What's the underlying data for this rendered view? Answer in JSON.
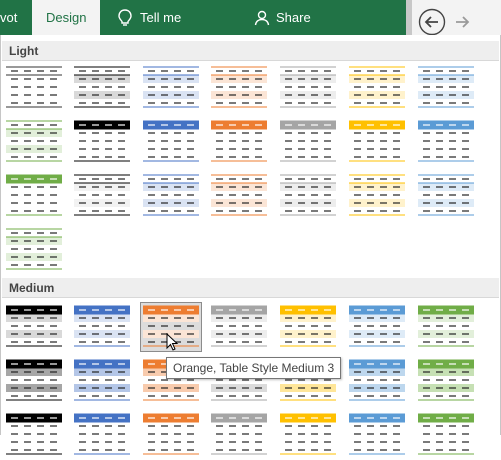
{
  "ribbon": {
    "tab_left_partial": "vot",
    "design_tab": "Design",
    "tell_me": "Tell me",
    "share": "Share",
    "back_icon": "back-arrow-icon",
    "forward_icon": "forward-arrow-icon"
  },
  "gallery": {
    "sections": [
      {
        "title": "Light"
      },
      {
        "title": "Medium"
      }
    ],
    "light": [
      {
        "accent": "#ffffff",
        "band": "#ffffff",
        "line": "#333333",
        "header_fill": false
      },
      {
        "accent": "#000000",
        "band": "#d9d9d9",
        "line": "#000000",
        "header_fill": false
      },
      {
        "accent": "#4472c4",
        "band": "#dae3f3",
        "line": "#4472c4",
        "header_fill": false
      },
      {
        "accent": "#ed7d31",
        "band": "#fbe5d6",
        "line": "#ed7d31",
        "header_fill": false
      },
      {
        "accent": "#a5a5a5",
        "band": "#ededed",
        "line": "#a5a5a5",
        "header_fill": false
      },
      {
        "accent": "#ffc000",
        "band": "#fff2cc",
        "line": "#ffc000",
        "header_fill": false
      },
      {
        "accent": "#5b9bd5",
        "band": "#deebf7",
        "line": "#5b9bd5",
        "header_fill": false
      },
      {
        "accent": "#70ad47",
        "band": "#e2efda",
        "line": "#70ad47",
        "header_fill": false
      },
      {
        "accent": "#000000",
        "band": "#ffffff",
        "line": "#000000",
        "header_fill": true
      },
      {
        "accent": "#4472c4",
        "band": "#ffffff",
        "line": "#4472c4",
        "header_fill": true
      },
      {
        "accent": "#ed7d31",
        "band": "#ffffff",
        "line": "#ed7d31",
        "header_fill": true
      },
      {
        "accent": "#a5a5a5",
        "band": "#ffffff",
        "line": "#a5a5a5",
        "header_fill": true
      },
      {
        "accent": "#ffc000",
        "band": "#ffffff",
        "line": "#ffc000",
        "header_fill": true
      },
      {
        "accent": "#5b9bd5",
        "band": "#ffffff",
        "line": "#5b9bd5",
        "header_fill": true
      },
      {
        "accent": "#70ad47",
        "band": "#ffffff",
        "line": "#70ad47",
        "header_fill": true
      },
      {
        "accent": "#000000",
        "band": "#f2f2f2",
        "line": "#000000",
        "header_fill": false
      },
      {
        "accent": "#4472c4",
        "band": "#dae3f3",
        "line": "#4472c4",
        "header_fill": false
      },
      {
        "accent": "#ed7d31",
        "band": "#fbe5d6",
        "line": "#ed7d31",
        "header_fill": false
      },
      {
        "accent": "#a5a5a5",
        "band": "#ededed",
        "line": "#a5a5a5",
        "header_fill": false
      },
      {
        "accent": "#ffc000",
        "band": "#fff2cc",
        "line": "#ffc000",
        "header_fill": false
      },
      {
        "accent": "#5b9bd5",
        "band": "#deebf7",
        "line": "#5b9bd5",
        "header_fill": false
      },
      {
        "accent": "#70ad47",
        "band": "#e2efda",
        "line": "#70ad47",
        "header_fill": false
      }
    ],
    "medium": [
      {
        "accent": "#000000",
        "band": "#d9d9d9",
        "line": "#000000",
        "header_fill": true
      },
      {
        "accent": "#4472c4",
        "band": "#dae3f3",
        "line": "#4472c4",
        "header_fill": true
      },
      {
        "accent": "#ed7d31",
        "band": "#fbe5d6",
        "line": "#ed7d31",
        "header_fill": true,
        "selected": true
      },
      {
        "accent": "#a5a5a5",
        "band": "#ededed",
        "line": "#a5a5a5",
        "header_fill": true
      },
      {
        "accent": "#ffc000",
        "band": "#fff2cc",
        "line": "#ffc000",
        "header_fill": true
      },
      {
        "accent": "#5b9bd5",
        "band": "#deebf7",
        "line": "#5b9bd5",
        "header_fill": true
      },
      {
        "accent": "#70ad47",
        "band": "#e2efda",
        "line": "#70ad47",
        "header_fill": true
      },
      {
        "accent": "#000000",
        "band": "#a6a6a6",
        "line": "#000000",
        "header_fill": true
      },
      {
        "accent": "#4472c4",
        "band": "#b4c6e7",
        "line": "#4472c4",
        "header_fill": true
      },
      {
        "accent": "#ed7d31",
        "band": "#f8cbad",
        "line": "#ed7d31",
        "header_fill": true
      },
      {
        "accent": "#a5a5a5",
        "band": "#dbdbdb",
        "line": "#a5a5a5",
        "header_fill": true
      },
      {
        "accent": "#ffc000",
        "band": "#ffe699",
        "line": "#ffc000",
        "header_fill": true
      },
      {
        "accent": "#5b9bd5",
        "band": "#bdd7ee",
        "line": "#5b9bd5",
        "header_fill": true
      },
      {
        "accent": "#70ad47",
        "band": "#c6e0b4",
        "line": "#70ad47",
        "header_fill": true
      },
      {
        "accent": "#000000",
        "band": "#ffffff",
        "line": "#000000",
        "header_fill": true
      },
      {
        "accent": "#4472c4",
        "band": "#ffffff",
        "line": "#4472c4",
        "header_fill": true
      },
      {
        "accent": "#ed7d31",
        "band": "#ffffff",
        "line": "#ed7d31",
        "header_fill": true
      },
      {
        "accent": "#a5a5a5",
        "band": "#ffffff",
        "line": "#a5a5a5",
        "header_fill": true
      },
      {
        "accent": "#ffc000",
        "band": "#ffffff",
        "line": "#ffc000",
        "header_fill": true
      },
      {
        "accent": "#5b9bd5",
        "band": "#ffffff",
        "line": "#5b9bd5",
        "header_fill": true
      },
      {
        "accent": "#70ad47",
        "band": "#ffffff",
        "line": "#70ad47",
        "header_fill": true
      }
    ]
  },
  "tooltip": {
    "text": "Orange, Table Style Medium 3"
  }
}
